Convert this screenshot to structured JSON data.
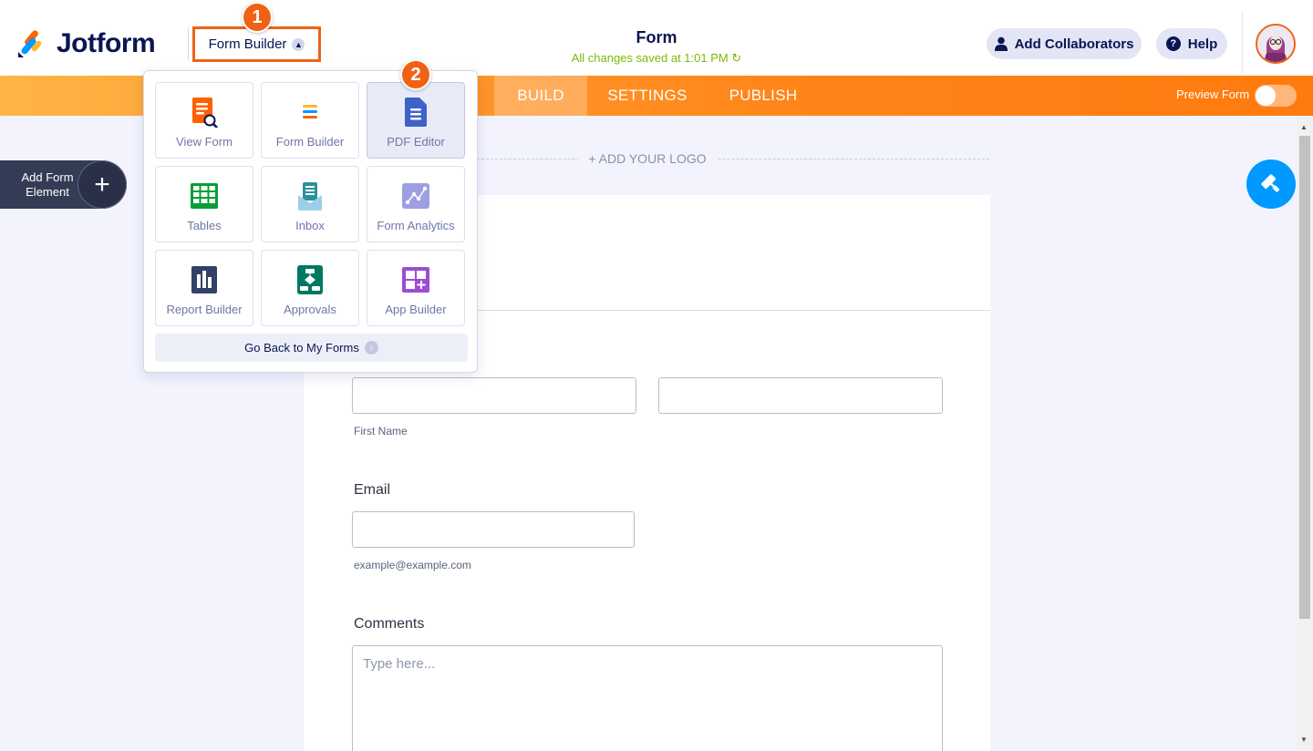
{
  "header": {
    "brand": "Jotform",
    "builder_button": "Form Builder",
    "form_title": "Form",
    "save_status": "All changes saved at 1:01 PM",
    "collaborators_button": "Add Collaborators",
    "help_button": "Help"
  },
  "annotations": {
    "step1": "1",
    "step2": "2"
  },
  "nav": {
    "tabs": [
      "BUILD",
      "SETTINGS",
      "PUBLISH"
    ],
    "active_tab": "BUILD",
    "preview_label": "Preview Form",
    "preview_enabled": false
  },
  "sidebar": {
    "add_element_label": "Add Form Element",
    "add_element_line1": "Add Form",
    "add_element_line2": "Element"
  },
  "dropdown": {
    "items": [
      {
        "label": "View Form",
        "icon": "view-form-icon",
        "color": "#ff6100"
      },
      {
        "label": "Form Builder",
        "icon": "form-builder-icon",
        "color": "#ff6100"
      },
      {
        "label": "PDF Editor",
        "icon": "pdf-editor-icon",
        "color": "#3e62c8",
        "active": true
      },
      {
        "label": "Tables",
        "icon": "tables-icon",
        "color": "#049e38"
      },
      {
        "label": "Inbox",
        "icon": "inbox-icon",
        "color": "#2d8f9e"
      },
      {
        "label": "Form Analytics",
        "icon": "analytics-icon",
        "color": "#9c9fe0"
      },
      {
        "label": "Report Builder",
        "icon": "report-builder-icon",
        "color": "#344067"
      },
      {
        "label": "Approvals",
        "icon": "approvals-icon",
        "color": "#007862"
      },
      {
        "label": "App Builder",
        "icon": "app-builder-icon",
        "color": "#9c4dd3"
      }
    ],
    "go_back": "Go Back to My Forms"
  },
  "form": {
    "logo_placeholder": "+ ADD YOUR LOGO",
    "first_name_sublabel": "First Name",
    "email_label": "Email",
    "email_sublabel": "example@example.com",
    "comments_label": "Comments",
    "comments_placeholder": "Type here..."
  },
  "colors": {
    "brand_orange": "#ef6214",
    "navy": "#0a1551",
    "accent_blue": "#0099ff",
    "saved_green": "#78bb07"
  }
}
